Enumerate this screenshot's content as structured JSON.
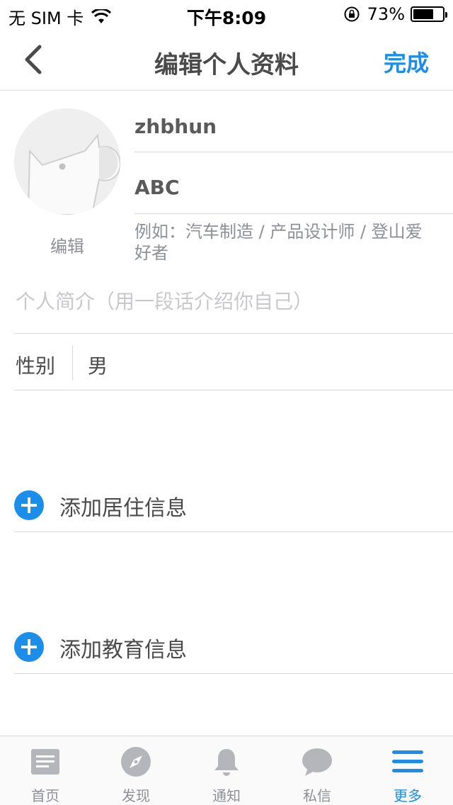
{
  "status_bar": {
    "carrier": "无 SIM 卡",
    "time": "下午8:09",
    "battery_text": "73%",
    "battery_level": 0.73,
    "icons": [
      "wifi-icon",
      "orientation-lock-icon",
      "battery-icon"
    ]
  },
  "nav": {
    "title": "编辑个人资料",
    "done_label": "完成",
    "accent_color": "#1c8de8"
  },
  "profile": {
    "avatar_edit_label": "编辑",
    "username": "zhbhun",
    "nickname": "ABC",
    "occupation_placeholder": "例如：汽车制造 / 产品设计师 / 登山爱好者",
    "bio_placeholder": "个人简介（用一段话介绍你自己）"
  },
  "gender": {
    "label": "性别",
    "value": "男"
  },
  "sections": {
    "add_residence": "添加居住信息",
    "add_education": "添加教育信息"
  },
  "tab_bar": {
    "items": [
      {
        "label": "首页",
        "icon": "home-icon",
        "active": false
      },
      {
        "label": "发现",
        "icon": "compass-icon",
        "active": false
      },
      {
        "label": "通知",
        "icon": "bell-icon",
        "active": false
      },
      {
        "label": "私信",
        "icon": "chat-bubble-icon",
        "active": false
      },
      {
        "label": "更多",
        "icon": "menu-icon",
        "active": true
      }
    ]
  }
}
